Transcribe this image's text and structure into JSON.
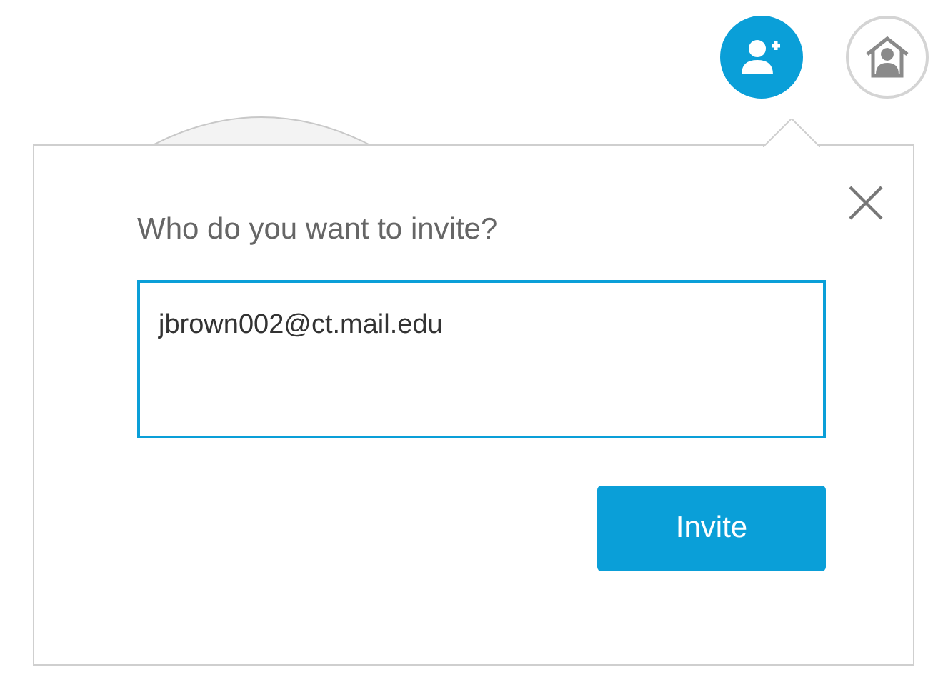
{
  "toolbar": {
    "invite_button": {
      "selected": true
    },
    "home_button": {
      "selected": false
    }
  },
  "invite_popup": {
    "heading": "Who do you want to invite?",
    "email_field": {
      "value": "jbrown002@ct.mail.edu"
    },
    "invite_button": "Invite"
  }
}
